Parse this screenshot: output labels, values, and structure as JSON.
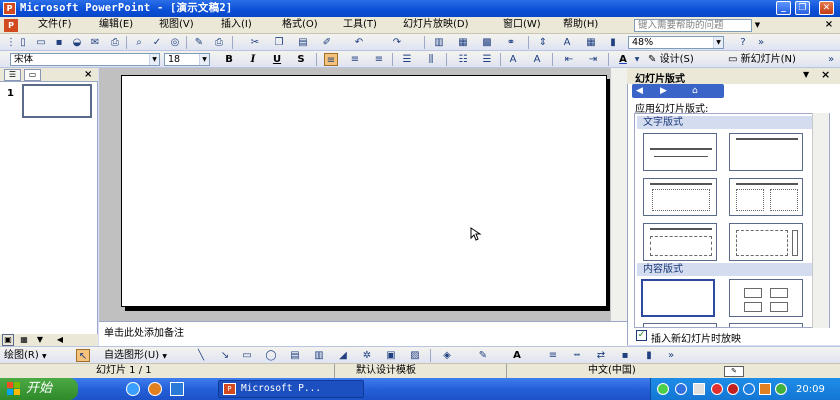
{
  "window": {
    "title": "Microsoft PowerPoint - [演示文稿2]",
    "app_icon": "P",
    "min_label": "_",
    "max_label": "❐",
    "close_label": "✕"
  },
  "menubar": {
    "items": [
      "文件(F)",
      "编辑(E)",
      "视图(V)",
      "插入(I)",
      "格式(O)",
      "工具(T)",
      "幻灯片放映(D)",
      "窗口(W)",
      "帮助(H)"
    ],
    "help_placeholder": "键入需要帮助的问题",
    "close_doc": "×"
  },
  "standard_toolbar": {
    "zoom": "48%"
  },
  "formatting_toolbar": {
    "font": "宋体",
    "font_size": "18",
    "bold": "B",
    "italic": "I",
    "underline": "U",
    "shadow": "S",
    "design_label": "设计(S)",
    "new_slide_label": "新幻灯片(N)"
  },
  "slides_pane": {
    "slide_number": "1"
  },
  "notes": {
    "placeholder": "单击此处添加备注"
  },
  "task_pane": {
    "title": "幻灯片版式",
    "apply_label": "应用幻灯片版式:",
    "section_text": "文字版式",
    "section_content": "内容版式",
    "insert_checkbox_label": "插入新幻灯片时放映"
  },
  "drawing_toolbar": {
    "draw_label": "绘图(R)",
    "autoshapes_label": "自选图形(U)"
  },
  "statusbar": {
    "slide_info": "幻灯片 1 / 1",
    "template": "默认设计模板",
    "language": "中文(中国)"
  },
  "taskbar": {
    "start_label": "开始",
    "ppt_task_label": "Microsoft P...",
    "clock": "20:09"
  }
}
